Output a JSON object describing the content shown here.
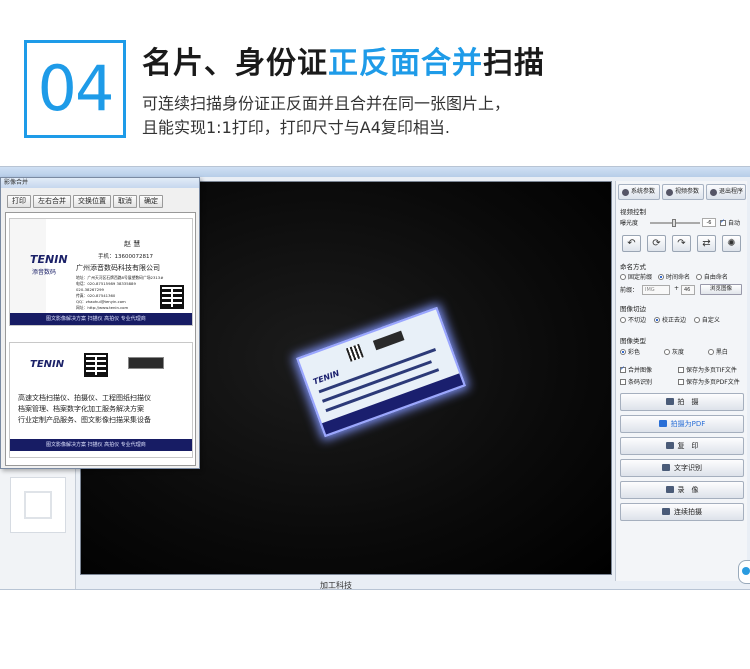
{
  "header": {
    "number": "04",
    "title_plain": "名片、身份证",
    "title_highlight": "正反面合并",
    "title_end": "扫描",
    "desc_line1": "可连续扫描身份证正反面并且合并在同一张图片上，",
    "desc_line2": "且能实现1:1打印，打印尺寸与A4复印相当."
  },
  "colors": {
    "accent": "#1e9be8",
    "card_bar": "#171c64"
  },
  "merge_window": {
    "title": "影像合并",
    "buttons": [
      "打印",
      "左右合并",
      "交换位置",
      "取消",
      "确定"
    ],
    "front_card": {
      "logo": "TENIN",
      "logo_sub": "添音数码",
      "name": "赵 慧",
      "mobile": "手机：13600072817",
      "company": "广州添音数码科技有限公司",
      "address": "地址：广州天河区石牌西路8号展望数码广场2313#",
      "tel": "电话：020-87515989 38335889",
      "tel2": "020-38267299",
      "fax": "传真：020-87541360",
      "qq": "QQ：zhaohui@tenyin.com",
      "web": "网址：http://www.tenin.com",
      "bar": "图文影像解决方案  扫描仪  高拍仪  专业代理商"
    },
    "back_card": {
      "logo": "TENIN",
      "line1": "高速文档扫描仪、拍摄仪、工程图纸扫描仪",
      "line2": "档案管理、档案数字化加工服务解决方案",
      "line3": "行业定制产品服务、图文影像扫描采集设备",
      "bar": "图文影像解决方案  扫描仪  高拍仪  专业代理商"
    }
  },
  "live_card": {
    "logo": "TENIN"
  },
  "status_text": "加工科技",
  "panel": {
    "top_buttons": [
      "系统参数",
      "视频参数",
      "退出程序"
    ],
    "video_control_label": "视频控制",
    "exposure_label": "曝光度",
    "exposure_value": "-6",
    "auto_label": "自动",
    "tool_icons": [
      "↶",
      "⟳",
      "↷",
      "⇄",
      "✺"
    ],
    "naming_label": "命名方式",
    "naming_options": [
      "固定前缀",
      "时间命名",
      "自由命名"
    ],
    "prefix_label": "前缀：",
    "prefix_value": "IMG",
    "counter_value": "46",
    "browse_label": "浏览图像",
    "crop_label": "图像切边",
    "crop_options": [
      "不切边",
      "校正去边",
      "自定义"
    ],
    "image_type_label": "图像类型",
    "image_type_options": [
      "彩色",
      "灰度",
      "黑白"
    ],
    "checks": [
      {
        "label": "合并图像",
        "checked": true
      },
      {
        "label": "保存为多页TIF文件",
        "checked": false
      },
      {
        "label": "条码识别",
        "checked": false
      },
      {
        "label": "保存为多页PDF文件",
        "checked": false
      }
    ],
    "actions": [
      "拍　摄",
      "拍摄为PDF",
      "复　印",
      "文字识别",
      "录　像",
      "连续拍摄"
    ]
  }
}
